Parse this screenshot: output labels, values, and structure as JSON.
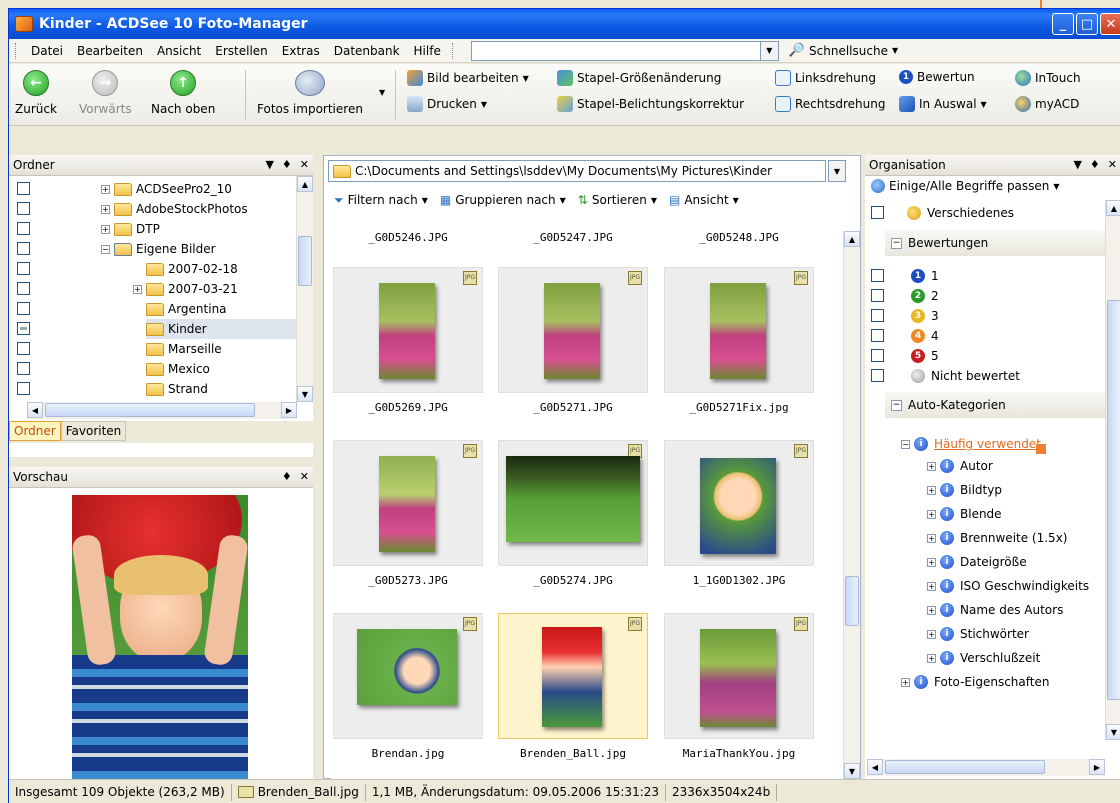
{
  "window": {
    "title": "Kinder - ACDSee 10 Foto-Manager"
  },
  "menu": {
    "items": [
      "Datei",
      "Bearbeiten",
      "Ansicht",
      "Erstellen",
      "Extras",
      "Datenbank",
      "Hilfe"
    ],
    "search_value": "",
    "quicksearch": "Schnellsuche"
  },
  "toolbar": {
    "back": "Zurück",
    "forward": "Vorwärts",
    "up": "Nach oben",
    "import": "Fotos importieren",
    "edit": "Bild bearbeiten",
    "print": "Drucken",
    "resize": "Stapel-Größenänderung",
    "exposure": "Stapel-Belichtungskorrektur",
    "rotate_left": "Linksdrehung",
    "rotate_right": "Rechtsdrehung",
    "rate": "Bewertun",
    "select": "In Auswal",
    "intouch": "InTouch",
    "myacd": "myACD"
  },
  "folders": {
    "title": "Ordner",
    "items": [
      {
        "label": "ACDSeePro2_10",
        "expander": "+"
      },
      {
        "label": "AdobeStockPhotos",
        "expander": "+"
      },
      {
        "label": "DTP",
        "expander": "+"
      },
      {
        "label": "Eigene Bilder",
        "expander": "−"
      },
      {
        "label": "2007-02-18",
        "expander": ""
      },
      {
        "label": "2007-03-21",
        "expander": "+"
      },
      {
        "label": "Argentina",
        "expander": ""
      },
      {
        "label": "Kinder",
        "expander": ""
      },
      {
        "label": "Marseille",
        "expander": ""
      },
      {
        "label": "Mexico",
        "expander": ""
      },
      {
        "label": "Strand",
        "expander": ""
      }
    ],
    "tabs": [
      "Ordner",
      "Favoriten"
    ]
  },
  "preview": {
    "title": "Vorschau"
  },
  "browser": {
    "path": "C:\\Documents and Settings\\lsddev\\My Documents\\My Pictures\\Kinder",
    "filter": "Filtern nach",
    "group": "Gruppieren nach",
    "sort": "Sortieren",
    "view": "Ansicht",
    "top_captions": [
      "_G0D5246.JPG",
      "_G0D5247.JPG",
      "_G0D5248.JPG"
    ],
    "files": [
      "_G0D5269.JPG",
      "_G0D5271.JPG",
      "_G0D5271Fix.jpg",
      "_G0D5273.JPG",
      "_G0D5274.JPG",
      "1_1G0D1302.JPG",
      "Brendan.jpg",
      "Brenden_Ball.jpg",
      "MariaThankYou.jpg"
    ],
    "jpg_badge": "JPG"
  },
  "organize": {
    "title": "Organisation",
    "match": "Einige/Alle Begriffe passen",
    "misc": "Verschiedenes",
    "ratings_header": "Bewertungen",
    "ratings": [
      {
        "n": "1",
        "label": "1",
        "color": "#1d4fc4"
      },
      {
        "n": "2",
        "label": "2",
        "color": "#2a9a2a"
      },
      {
        "n": "3",
        "label": "3",
        "color": "#e8b820"
      },
      {
        "n": "4",
        "label": "4",
        "color": "#f08a20"
      },
      {
        "n": "5",
        "label": "5",
        "color": "#c82020"
      }
    ],
    "unrated": "Nicht bewertet",
    "auto_header": "Auto-Kategorien",
    "frequent": "Häufig verwendet",
    "categories": [
      "Autor",
      "Bildtyp",
      "Blende",
      "Brennweite (1.5x)",
      "Dateigröße",
      "ISO Geschwindigkeits",
      "Name des Autors",
      "Stichwörter",
      "Verschlußzeit"
    ],
    "photo_props": "Foto-Eigenschaften"
  },
  "status": {
    "total": "Insgesamt 109 Objekte (263,2 MB)",
    "file": "Brenden_Ball.jpg",
    "info": "1,1 MB, Änderungsdatum: 09.05.2006 15:31:23",
    "dims": "2336x3504x24b"
  }
}
